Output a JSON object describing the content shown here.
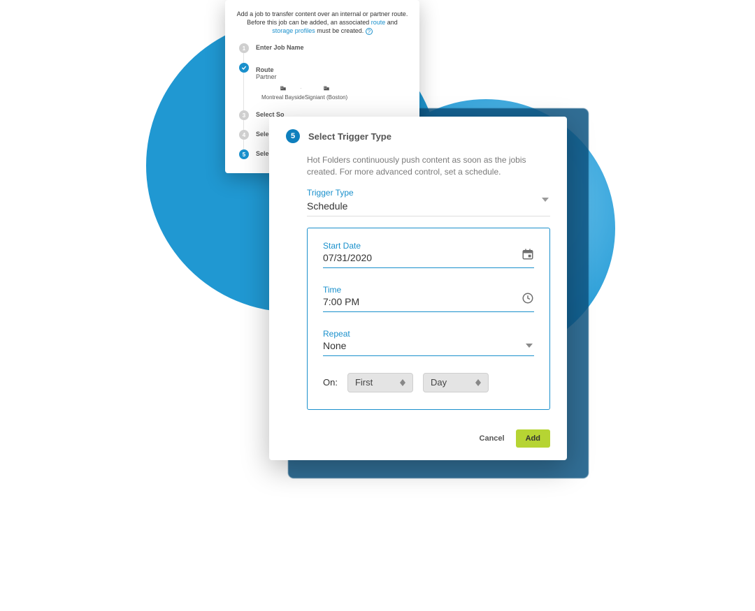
{
  "wizard": {
    "intro_pre": "Add a job to transfer content over an internal or partner route. Before this job can be added, an associated ",
    "link_route": "route",
    "intro_mid": " and ",
    "link_storage": "storage profiles",
    "intro_post": " must be created. ",
    "steps": [
      {
        "num": "1",
        "label": "Enter Job Name"
      },
      {
        "num": "✓",
        "label": "Route",
        "sub": "Partner"
      },
      {
        "num": "3",
        "label": "Select So"
      },
      {
        "num": "4",
        "label": "Select S"
      },
      {
        "num": "5",
        "label": "Select Tri"
      }
    ],
    "route_from": "Montreal Bayside",
    "route_to": "Signiant (Boston)"
  },
  "trigger": {
    "step_num": "5",
    "title": "Select Trigger Type",
    "desc": "Hot Folders continuously push content as soon as the jobis created. For more advanced control, set a schedule.",
    "type_label": "Trigger Type",
    "type_value": "Schedule",
    "start_label": "Start Date",
    "start_value": "07/31/2020",
    "time_label": "Time",
    "time_value": "7:00 PM",
    "repeat_label": "Repeat",
    "repeat_value": "None",
    "on_label": "On:",
    "on_first": "First",
    "on_day": "Day",
    "cancel": "Cancel",
    "add": "Add"
  },
  "colors": {
    "accent": "#1a90cc",
    "add_btn": "#b6d433"
  }
}
